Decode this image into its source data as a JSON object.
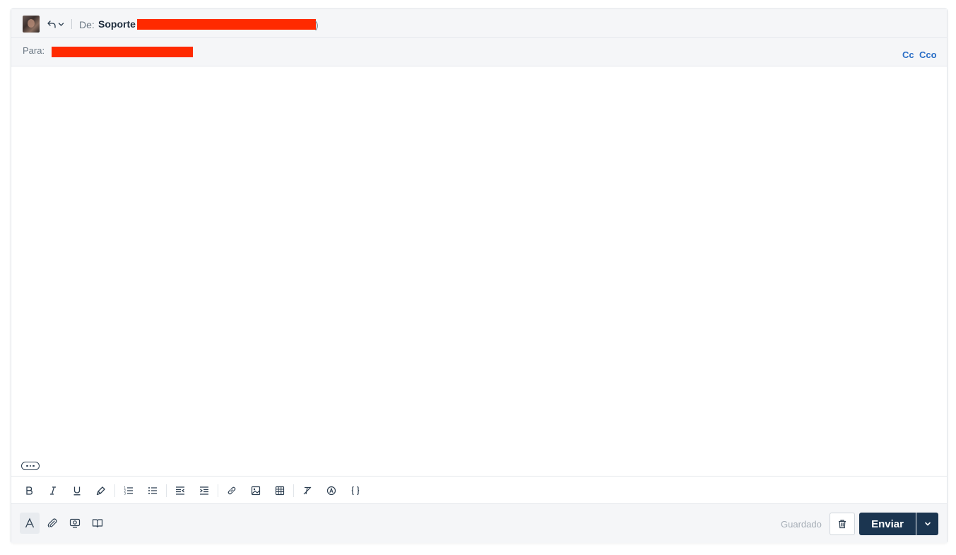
{
  "header": {
    "from_label": "De:",
    "from_name": "Soporte",
    "from_tail": ")"
  },
  "to_row": {
    "to_label": "Para:",
    "cc_label": "Cc",
    "cco_label": "Cco"
  },
  "footer": {
    "saved_label": "Guardado",
    "send_label": "Enviar"
  },
  "icons": {
    "toolbar": [
      "bold-icon",
      "italic-icon",
      "underline-icon",
      "highlight-icon",
      "ordered-list-icon",
      "bulleted-list-icon",
      "outdent-icon",
      "indent-icon",
      "link-icon",
      "image-icon",
      "table-icon",
      "clear-format-icon",
      "spellcheck-icon",
      "code-braces-icon"
    ],
    "footer_tools": [
      "text-format-icon",
      "attachment-icon",
      "screen-capture-icon",
      "knowledge-base-icon"
    ]
  },
  "colors": {
    "accent": "#2a6ec6",
    "primary_button": "#1b3550",
    "redaction": "#ff2a00"
  }
}
